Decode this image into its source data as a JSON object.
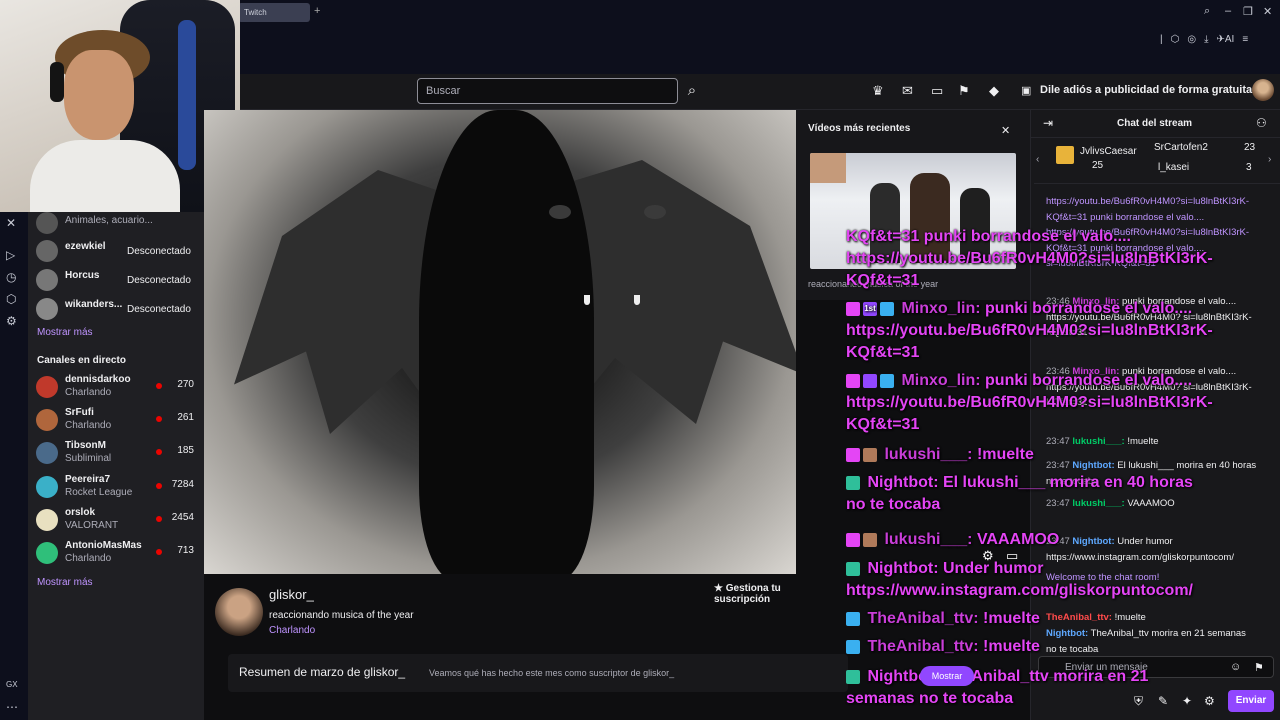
{
  "browser": {
    "tab_label": "Twitch",
    "new_tab": "+",
    "ext_label": "AI"
  },
  "nav": {
    "search_placeholder": "Buscar",
    "adfree": "Dile adiós a publicidad de forma gratuita"
  },
  "sidebar": {
    "followed": [
      {
        "name": "",
        "sub": "Animales, acuario...",
        "status": ""
      },
      {
        "name": "ezewkiel",
        "sub": "",
        "status": "Desconectado"
      },
      {
        "name": "Horcus",
        "sub": "",
        "status": "Desconectado"
      },
      {
        "name": "wikanders...",
        "sub": "",
        "status": "Desconectado"
      }
    ],
    "more1": "Mostrar más",
    "live_head": "Canales en directo",
    "live": [
      {
        "name": "dennisdarkoo",
        "sub": "Charlando",
        "count": "270",
        "color": "#c0392b"
      },
      {
        "name": "SrFufi",
        "sub": "Charlando",
        "count": "261",
        "color": "#b0663c"
      },
      {
        "name": "TibsonM",
        "sub": "Subliminal",
        "count": "185",
        "color": "#4a6a8a"
      },
      {
        "name": "Peereira7",
        "sub": "Rocket League",
        "count": "7284",
        "color": "#3ab0c8"
      },
      {
        "name": "orslok",
        "sub": "VALORANT",
        "count": "2454",
        "color": "#e8e0c0"
      },
      {
        "name": "AntonioMasMas",
        "sub": "Charlando",
        "count": "713",
        "color": "#2fbf7a"
      }
    ],
    "more2": "Mostrar más",
    "rail_bottom": "GX"
  },
  "stream": {
    "streamer": "gliskor_",
    "title": "reaccionando musica of the year",
    "category": "Charlando",
    "sub_button": "Gestiona tu suscripción",
    "recap_title": "Resumen de marzo de gliskor_",
    "recap_sub": "Veamos qué has hecho este mes como suscriptor de gliskor_"
  },
  "recent": {
    "title": "Vídeos más recientes",
    "caption": "reaccionando musica of the year"
  },
  "overlay": {
    "lines": [
      "KQf&t=31 punki borrandose el valo....",
      "https://youtu.be/Bu6fR0vH4M0?si=lu8lnBtKI3rK-",
      "KQf&t=31",
      "Minxo_lin:",
      "punki borrandose el valo....",
      "https://youtu.be/Bu6fR0vH4M0?si=lu8lnBtKI3rK-",
      "KQf&t=31",
      "Minxo_lin:",
      "punki borrandose el valo....",
      "https://youtu.be/Bu6fR0vH4M0?si=lu8lnBtKI3rK-",
      "KQf&t=31",
      "lukushi___:",
      "!muelte",
      "Nightbot:",
      "El lukushi___ morira en 40 horas",
      "no te tocaba",
      "lukushi___:",
      "VAAAMOO",
      "Nightbot:",
      "Under humor",
      "https://www.instagram.com/gliskorpuntocom/",
      "TheAnibal_ttv:",
      "!muelte",
      "TheAnibal_ttv:",
      "!muelte",
      "Nightbot:",
      "TheAnibal_ttv morira en 21",
      "semanas no te tocaba",
      "1st"
    ],
    "mostrar_pill": "Mostrar"
  },
  "chat": {
    "title": "Chat del stream",
    "gifters": [
      {
        "name": "JvlivsCaesar",
        "count": "25"
      },
      {
        "name": "SrCartofen2",
        "count": "23"
      },
      {
        "name": "l_kasei",
        "count": "3"
      }
    ],
    "messages": [
      {
        "ts": "",
        "user": "",
        "text": "https://youtu.be/Bu6fR0vH4M0?si=lu8lnBtKI3rK-KQf&t=31 punki borrandose el valo...."
      },
      {
        "ts": "",
        "user": "",
        "text": "https://youtu.be/Bu6fR0vH4M0?si=lu8lnBtKI3rK-KQf&t=31 punki borrandose el valo...."
      },
      {
        "ts": "",
        "user": "",
        "text": "si=lu8lnBtKI3rK-KQf&t=31"
      },
      {
        "ts": "23:46",
        "user": "Minxo_lin:",
        "text": "punki borrandose el valo.... https://youtu.be/Bu6fR0vH4M0? si=lu8lnBtKI3rK-KQf&t=31"
      },
      {
        "ts": "23:46",
        "user": "Minxo_lin:",
        "text": "punki borrandose el valo.... https://youtu.be/Bu6fR0vH4M0? si=lu8lnBtKI3rK-KQf&t=31"
      },
      {
        "ts": "23:47",
        "user": "lukushi___:",
        "text": "!muelte"
      },
      {
        "ts": "23:47",
        "user": "Nightbot:",
        "text": "El lukushi___ morira en 40 horas no te tocaba"
      },
      {
        "ts": "23:47",
        "user": "lukushi___:",
        "text": "VAAAMOO"
      },
      {
        "ts": "23:47",
        "user": "Nightbot:",
        "text": "Under humor https://www.instagram.com/gliskorpuntocom/"
      },
      {
        "ts": "",
        "user": "",
        "text": "Welcome to the chat room!"
      },
      {
        "ts": "",
        "user": "TheAnibal_ttv:",
        "text": "!muelte"
      },
      {
        "ts": "",
        "user": "Nightbot:",
        "text": "TheAnibal_ttv morira en 21 semanas no te tocaba"
      }
    ],
    "input_placeholder": "Enviar un mensaje",
    "send": "Enviar"
  }
}
